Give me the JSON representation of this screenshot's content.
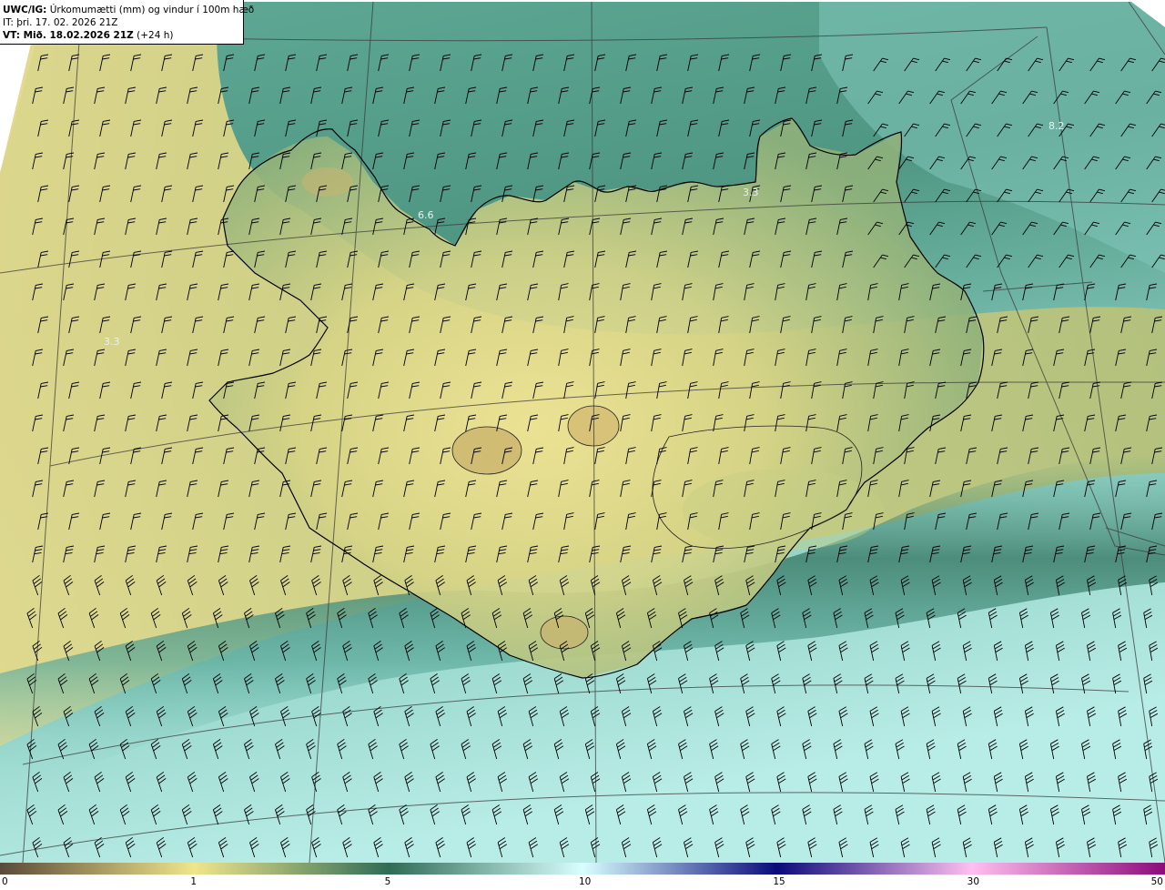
{
  "info": {
    "model_label": "UWC/IG:",
    "description": "Úrkomumætti (mm) og vindur í 100m hæð",
    "it_line": "IT: þri. 17. 02. 2026 21Z",
    "vt_label": "VT: Mið. 18.02.2026 21Z",
    "vt_offset": "(+24 h)"
  },
  "point_values": [
    {
      "text": "6.6"
    },
    {
      "text": "3.3"
    },
    {
      "text": "3.3"
    },
    {
      "text": "8.2"
    }
  ],
  "colorbar": {
    "segments": [
      {
        "from": 0,
        "to": 1,
        "color_start": "#5a4a3a",
        "color_end": "#f0e68c"
      },
      {
        "from": 1,
        "to": 5,
        "color_start": "#f0e68c",
        "color_end": "#2f6b55"
      },
      {
        "from": 5,
        "to": 10,
        "color_start": "#2f6b55",
        "color_end": "#d9ffff"
      },
      {
        "from": 10,
        "to": 15,
        "color_start": "#d9ffff",
        "color_end": "#0a0a7a"
      },
      {
        "from": 15,
        "to": 30,
        "color_start": "#0a0a7a",
        "color_end": "#ffc0f0"
      },
      {
        "from": 30,
        "to": 50,
        "color_start": "#ffc0f0",
        "color_end": "#8b0a7a"
      }
    ],
    "tick_labels": [
      "0",
      "1",
      "5",
      "10",
      "15",
      "30",
      "50"
    ]
  },
  "colors": {
    "land_low": "#e9df8f",
    "land_mid": "#c6c47a",
    "sea_green": "#4f9783",
    "sea_teal": "#7cc2b6",
    "sea_light": "#b8ece6",
    "border": "#000000"
  }
}
